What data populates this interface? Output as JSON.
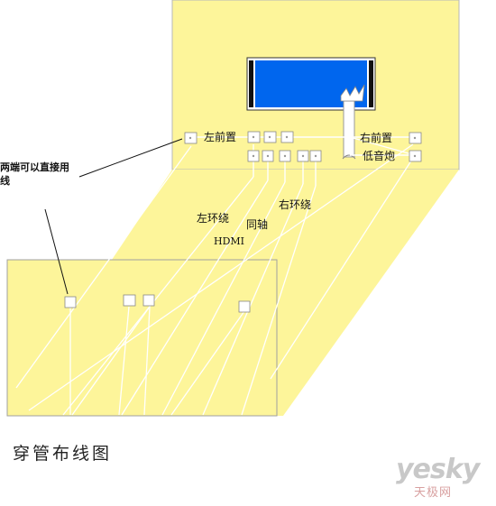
{
  "labels": {
    "left_front": "左前置",
    "right_front": "右前置",
    "subwoofer": "低音炮",
    "left_surround": "左环绕",
    "hdmi": "HDMI",
    "coaxial": "同轴",
    "right_surround": "右环绕"
  },
  "note": "两端可以直接用线",
  "title": "穿管布线图",
  "watermark": {
    "logo": "yesky",
    "sub": "天极网"
  },
  "colors": {
    "wall": "#fdf59a",
    "screen": "#0066ee",
    "line": "#ffffff",
    "outline": "#999999"
  }
}
